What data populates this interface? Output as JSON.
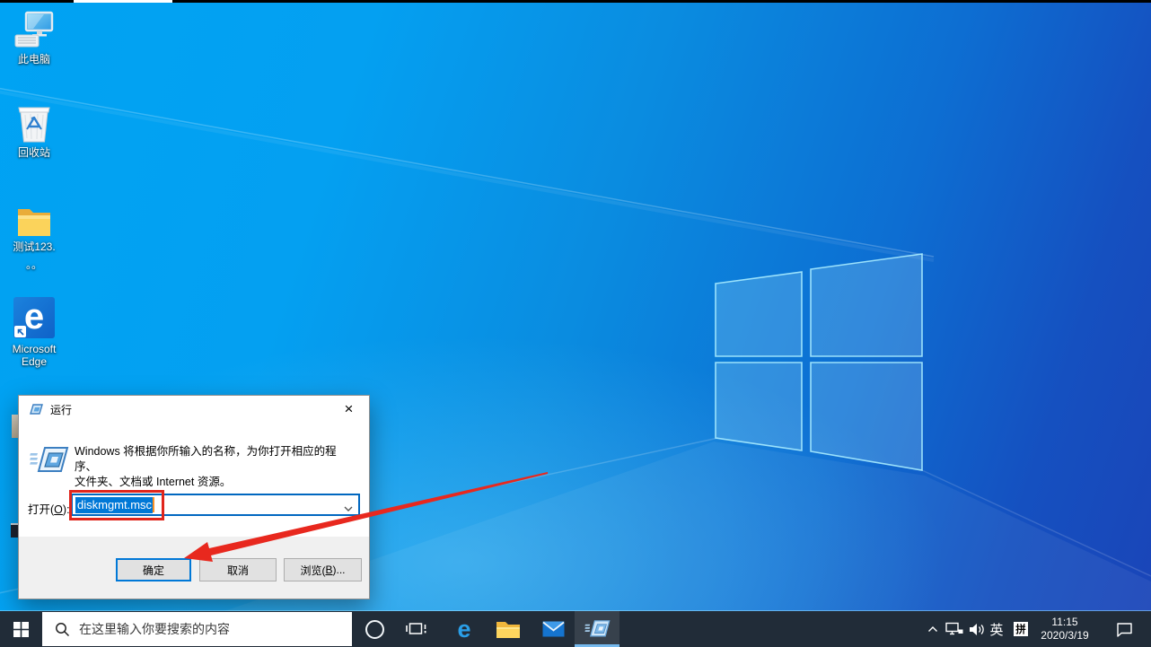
{
  "desktop_icons": [
    {
      "label": "此电脑"
    },
    {
      "label": "回收站"
    },
    {
      "label": "测试123.",
      "label_line2": "。。"
    },
    {
      "label": "Microsoft",
      "label_line2": "Edge"
    }
  ],
  "run_dialog": {
    "title": "运行",
    "close_glyph": "×",
    "description_line1": "Windows 将根据你所输入的名称，为你打开相应的程序、",
    "description_line2": "文件夹、文档或 Internet 资源。",
    "open_label_pre": "打开(",
    "open_label_mnemonic": "O",
    "open_label_post": "):",
    "input_value": "diskmgmt.msc",
    "ok_label": "确定",
    "cancel_label": "取消",
    "browse_pre": "浏览(",
    "browse_mnemonic": "B",
    "browse_post": ")..."
  },
  "taskbar": {
    "search_placeholder": "在这里输入你要搜索的内容",
    "ime_language": "英",
    "ime_mode": "拼",
    "time": "11:15",
    "date": "2020/3/19"
  },
  "colors": {
    "selection_blue": "#0078d7",
    "annotation_red": "#e0251c",
    "taskbar_bg": "#212c38",
    "active_underline": "#76b9ed",
    "wallpaper_azure": "#02a2f2",
    "wallpaper_deep": "#1a45b8"
  }
}
